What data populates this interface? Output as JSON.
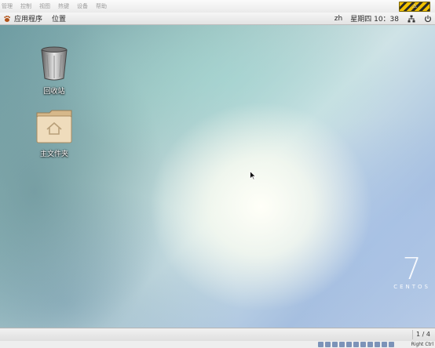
{
  "vbox": {
    "menu": [
      "管理",
      "控制",
      "视图",
      "热键",
      "设备",
      "帮助"
    ],
    "host_key": "Right Ctrl"
  },
  "panel": {
    "applications_label": "应用程序",
    "places_label": "位置",
    "input_method": "zh",
    "clock": "星期四 10：38",
    "icons": [
      "gnome-foot-icon",
      "network-icon",
      "power-icon"
    ]
  },
  "desktop": {
    "icons": [
      {
        "label": "回收站",
        "icon": "trash-icon"
      },
      {
        "label": "主文件夹",
        "icon": "home-folder-icon"
      }
    ],
    "branding": {
      "number": "7",
      "text": "CENTOS"
    }
  },
  "workspace": {
    "indicator": "1 / 4"
  },
  "colors": {
    "desktop_accent": "#9fc5c3",
    "vbox_logo": "#f2c200"
  }
}
